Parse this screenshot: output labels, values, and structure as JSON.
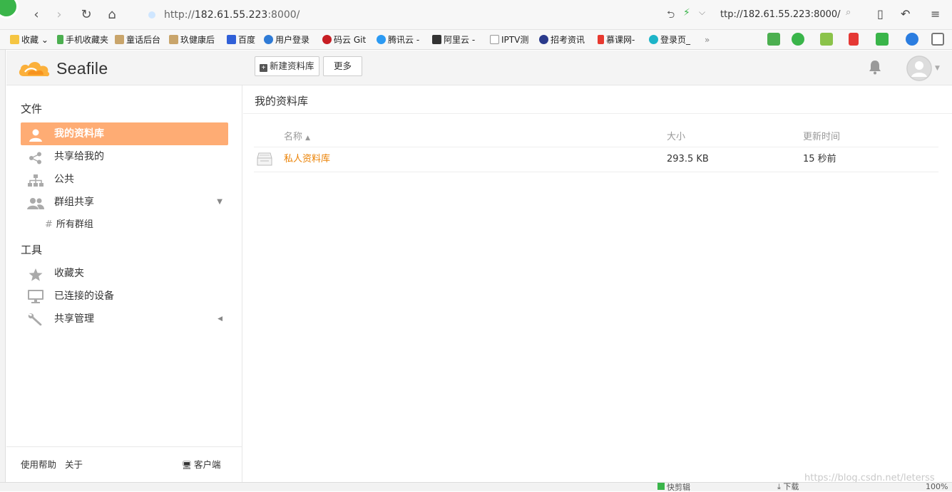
{
  "browser": {
    "url": "http://182.61.55.223:8000/",
    "url_host": "182.61.55.223",
    "url_prefix": "http://",
    "url_suffix": ":8000/",
    "side_url": "ttp://182.61.55.223:8000/",
    "bookmarks": [
      "收藏",
      "手机收藏夹",
      "童话后台",
      "玖健康后",
      "百度",
      "用户登录",
      "码云 Git",
      "腾讯云 -",
      "阿里云 -",
      "IPTV测",
      "招考资讯",
      "慕课网-",
      "登录页_"
    ],
    "more": "»"
  },
  "header": {
    "logo": "Seafile",
    "new_library_button": "新建资料库",
    "more_button": "更多"
  },
  "sidebar": {
    "files_title": "文件",
    "items": [
      {
        "label": "我的资料库",
        "icon": "user-icon",
        "active": true
      },
      {
        "label": "共享给我的",
        "icon": "share-icon",
        "active": false
      },
      {
        "label": "公共",
        "icon": "org-icon",
        "active": false
      },
      {
        "label": "群组共享",
        "icon": "group-icon",
        "active": false
      }
    ],
    "all_groups": "所有群组",
    "tools_title": "工具",
    "tools": [
      {
        "label": "收藏夹",
        "icon": "star-icon"
      },
      {
        "label": "已连接的设备",
        "icon": "monitor-icon"
      },
      {
        "label": "共享管理",
        "icon": "wrench-icon"
      }
    ],
    "footer": {
      "help": "使用帮助",
      "about": "关于",
      "client": "客户端"
    }
  },
  "main": {
    "title": "我的资料库",
    "columns": {
      "name": "名称",
      "size": "大小",
      "updated": "更新时间"
    },
    "rows": [
      {
        "name": "私人资料库",
        "size": "293.5 KB",
        "updated": "15 秒前"
      }
    ]
  },
  "status": {
    "left": "快剪辑",
    "download": "下载",
    "zoom": "100%",
    "watermark": "https://blog.csdn.net/leterss"
  }
}
